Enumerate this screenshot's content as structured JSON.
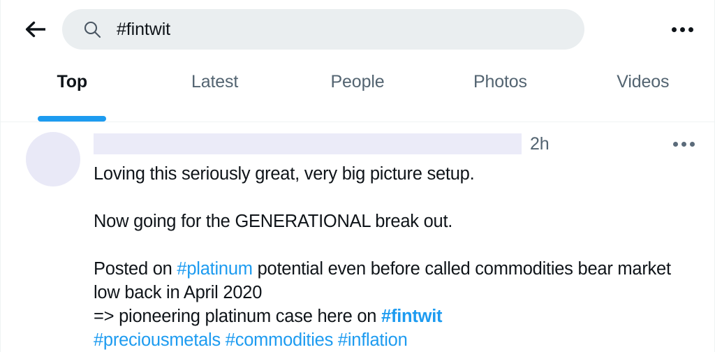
{
  "header": {
    "back_icon": "arrow-left-icon",
    "search": {
      "icon": "search-icon",
      "value": "#fintwit",
      "placeholder": "Search Twitter"
    },
    "overflow_icon": "more-horizontal-icon"
  },
  "tabs": [
    {
      "label": "Top",
      "active": true
    },
    {
      "label": "Latest",
      "active": false
    },
    {
      "label": "People",
      "active": false
    },
    {
      "label": "Photos",
      "active": false
    },
    {
      "label": "Videos",
      "active": false
    }
  ],
  "tweet": {
    "avatar_icon": "avatar-placeholder",
    "display_name_redacted": "",
    "timestamp": "2h",
    "overflow_icon": "more-horizontal-icon",
    "paragraphs": [
      [
        {
          "text": "Loving this seriously great, very big picture setup.",
          "style": "plain"
        }
      ],
      [],
      [
        {
          "text": "Now going for the GENERATIONAL break out.",
          "style": "plain"
        }
      ],
      [],
      [
        {
          "text": "Posted on ",
          "style": "plain"
        },
        {
          "text": "#platinum",
          "style": "link"
        },
        {
          "text": " potential even before called commodities bear market low back in April 2020\n=> pioneering platinum case here on ",
          "style": "plain"
        },
        {
          "text": "#fintwit",
          "style": "link-bold"
        },
        {
          "text": "\n",
          "style": "plain"
        },
        {
          "text": "#preciousmetals",
          "style": "link"
        },
        {
          "text": " ",
          "style": "plain"
        },
        {
          "text": "#commodities",
          "style": "link"
        },
        {
          "text": " ",
          "style": "plain"
        },
        {
          "text": "#inflation",
          "style": "link"
        }
      ]
    ]
  },
  "colors": {
    "accent": "#1d9bf0",
    "text_primary": "#0f1419",
    "text_secondary": "#536471",
    "search_bg": "#eaeef0",
    "redaction": "#ebebf8",
    "avatar": "#e9e9f7",
    "divider": "#eff3f4"
  }
}
